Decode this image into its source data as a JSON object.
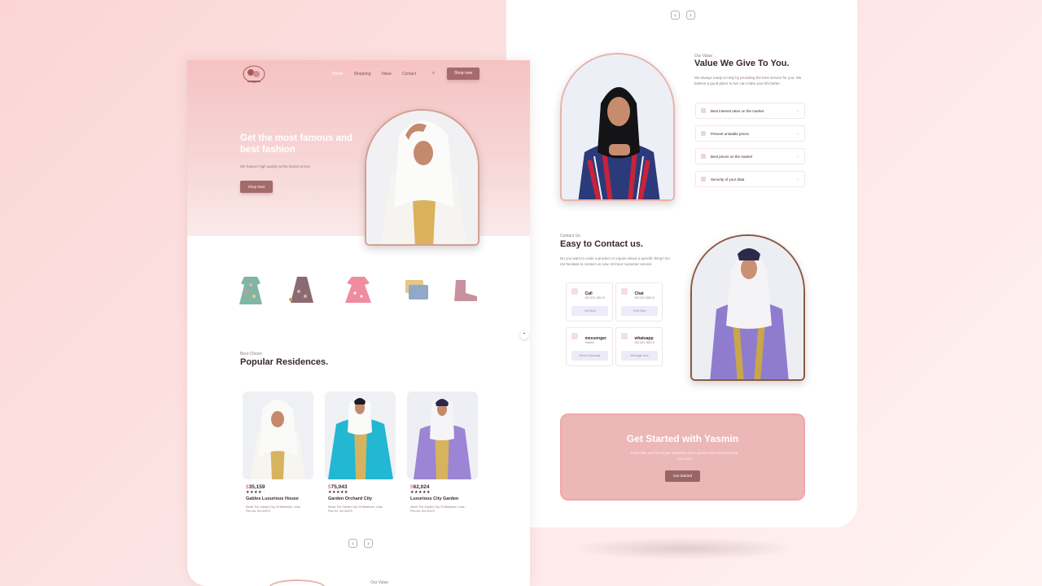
{
  "right_page": {
    "value": {
      "eyebrow": "Our Value",
      "title": "Value We Give To You.",
      "desc": "We always ready to help by providing the best service for you. We believe a good place to live can make your life better.",
      "items": [
        {
          "label": "Best interest rates on the market"
        },
        {
          "label": "Prevent unstable prices"
        },
        {
          "label": "Best prices on the market"
        },
        {
          "label": "Security of your data"
        }
      ]
    },
    "contact": {
      "eyebrow": "Contact Us",
      "title": "Easy to Contact us.",
      "desc": "Do you want to order a product or inquire about a specific thing? Do not hesitate to contact us now. 24-hour customer service",
      "cards": [
        {
          "title": "Call",
          "sub": "022.321.165.19",
          "button": "Call Now"
        },
        {
          "title": "Chat",
          "sub": "022.321.165.19",
          "button": "Chat Now"
        },
        {
          "title": "messenger",
          "sub": "Yasmin",
          "button": "Send a Message"
        },
        {
          "title": "whatsapp",
          "sub": "022.321.165.19",
          "button": "Message Now"
        }
      ]
    },
    "cta": {
      "title": "Get Started with Yasmin",
      "desc": "Subscribe and find super attractive price quotes from us Find what suits you",
      "button": "Get Started"
    }
  },
  "left_page": {
    "nav": {
      "items": [
        "Home",
        "Shopping",
        "Value",
        "Contact"
      ],
      "shop_button": "Shop now"
    },
    "hero": {
      "title": "Get the most famous and best fashion",
      "subtitle": "We feature high quality at the lowest prices",
      "button": "Shop Now"
    },
    "section": {
      "eyebrow": "Best Choice",
      "title": "Popular Residences."
    },
    "listings": [
      {
        "currency": "$",
        "price": "35,159",
        "rating": 4,
        "name": "Gables Luxurious House",
        "address": "Street The Garden City Of Miraflores, Lima - Peru Av. Sol #1675"
      },
      {
        "currency": "$",
        "price": "75,043",
        "rating": 5,
        "name": "Garden Orchard City",
        "address": "Street The Garden City Of Miraflores, Lima - Peru Av. Sol #1675"
      },
      {
        "currency": "$",
        "price": "62,024",
        "rating": 5,
        "name": "Luxurious City Garden",
        "address": "Street The Garden City Of Miraflores, Lima - Peru Av. Sol #1675"
      }
    ],
    "footer_eyebrow": "Our Value"
  },
  "colors": {
    "accent": "#a56a6c",
    "pink": "#f6c2c2",
    "cta_bg": "#ecb7b7"
  }
}
